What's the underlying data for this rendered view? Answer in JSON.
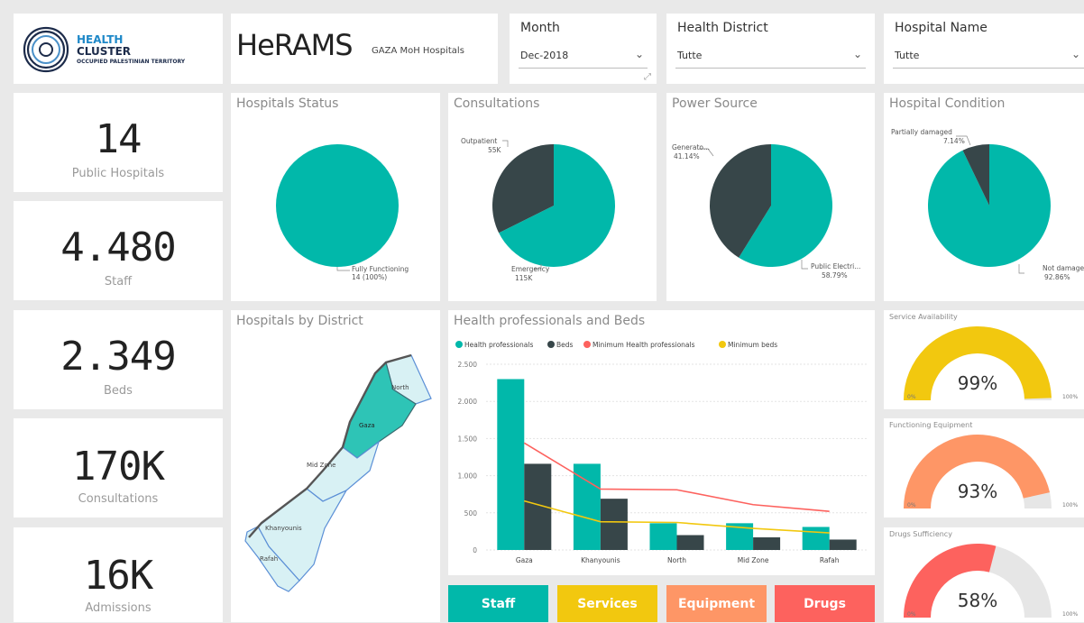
{
  "header": {
    "logo": {
      "line1": "HEALTH",
      "line2": "CLUSTER",
      "line3": "OCCUPIED PALESTINIAN TERRITORY"
    },
    "title": "HeRAMS",
    "subtitle": "GAZA MoH Hospitals"
  },
  "filters": {
    "month": {
      "label": "Month",
      "value": "Dec-2018"
    },
    "district": {
      "label": "Health District",
      "value": "Tutte"
    },
    "hospital": {
      "label": "Hospital Name",
      "value": "Tutte"
    }
  },
  "kpis": [
    {
      "value": "14",
      "label": "Public Hospitals"
    },
    {
      "value": "4.480",
      "label": "Staff"
    },
    {
      "value": "2.349",
      "label": "Beds"
    },
    {
      "value": "170K",
      "label": "Consultations"
    },
    {
      "value": "16K",
      "label": "Admissions"
    }
  ],
  "colors": {
    "teal": "#01b8aa",
    "dark": "#374649",
    "red": "#fd625e",
    "yellow": "#f2c80f",
    "orange": "#fe9666",
    "gaugeBg": "#e6e6e6"
  },
  "pies": {
    "status": {
      "title": "Hospitals Status",
      "slices": [
        {
          "label1": "Fully Functioning",
          "label2": "14 (100%)",
          "value": 100
        }
      ]
    },
    "consultations": {
      "title": "Consultations",
      "slices": [
        {
          "label1": "Emergency",
          "label2": "115K",
          "value": 115
        },
        {
          "label1": "Outpatient",
          "label2": "55K",
          "value": 55
        }
      ]
    },
    "power": {
      "title": "Power Source",
      "slices": [
        {
          "label1": "Public Electri...",
          "label2": "58.79%",
          "value": 58.79
        },
        {
          "label1": "Generato...",
          "label2": "41.14%",
          "value": 41.14
        }
      ]
    },
    "condition": {
      "title": "Hospital Condition",
      "slices": [
        {
          "label1": "Not damaged",
          "label2": "92.86%",
          "value": 92.86
        },
        {
          "label1": "Partially damaged",
          "label2": "7.14%",
          "value": 7.14
        }
      ]
    }
  },
  "map": {
    "title": "Hospitals by District",
    "districts": [
      {
        "name": "North"
      },
      {
        "name": "Gaza"
      },
      {
        "name": "Mid Zone"
      },
      {
        "name": "Khanyounis"
      },
      {
        "name": "Rafah"
      }
    ]
  },
  "chart_data": {
    "type": "bar",
    "title": "Health professionals and Beds",
    "categories": [
      "Gaza",
      "Khanyounis",
      "North",
      "Mid Zone",
      "Rafah"
    ],
    "series": [
      {
        "name": "Health professionals",
        "kind": "bar",
        "values": [
          2300,
          1160,
          360,
          360,
          310
        ]
      },
      {
        "name": "Beds",
        "kind": "bar",
        "values": [
          1160,
          690,
          200,
          170,
          140
        ]
      },
      {
        "name": "Minimum Health professionals",
        "kind": "line",
        "values": [
          1440,
          820,
          810,
          610,
          520
        ]
      },
      {
        "name": "Minimum beds",
        "kind": "line",
        "values": [
          660,
          380,
          370,
          290,
          230
        ]
      }
    ],
    "yticks": [
      "0",
      "500",
      "1.000",
      "1.500",
      "2.000",
      "2.500"
    ],
    "ylim": [
      0,
      2500
    ],
    "legend": "top-left"
  },
  "gauges": [
    {
      "title": "Service Availability",
      "value": 99,
      "display": "99%",
      "min": "0%",
      "max": "100%",
      "color": "#f2c80f"
    },
    {
      "title": "Functioning Equipment",
      "value": 93,
      "display": "93%",
      "min": "0%",
      "max": "100%",
      "color": "#fe9666"
    },
    {
      "title": "Drugs Sufficiency",
      "value": 58,
      "display": "58%",
      "min": "0%",
      "max": "100%",
      "color": "#fd625e"
    }
  ],
  "buttons": [
    {
      "label": "Staff",
      "color": "#01b8aa"
    },
    {
      "label": "Services",
      "color": "#f2c80f"
    },
    {
      "label": "Equipment",
      "color": "#fe9666"
    },
    {
      "label": "Drugs",
      "color": "#fd625e"
    }
  ]
}
